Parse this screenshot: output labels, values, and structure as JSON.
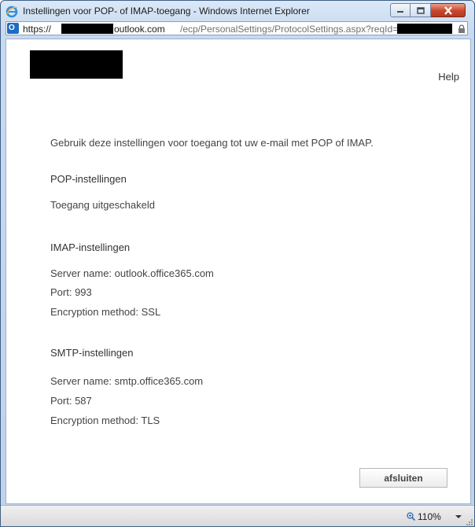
{
  "window": {
    "title": "Instellingen voor POP- of IMAP-toegang - Windows Internet Explorer"
  },
  "address": {
    "scheme": "https://",
    "domain": "outlook.com",
    "path": "/ecp/PersonalSettings/ProtocolSettings.aspx?reqId="
  },
  "page": {
    "help": "Help",
    "intro": "Gebruik deze instellingen voor toegang tot uw e-mail met POP of IMAP.",
    "pop": {
      "heading": "POP-instellingen",
      "status": "Toegang uitgeschakeld"
    },
    "imap": {
      "heading": "IMAP-instellingen",
      "server": "Server name: outlook.office365.com",
      "port": "Port: 993",
      "encryption": "Encryption method: SSL"
    },
    "smtp": {
      "heading": "SMTP-instellingen",
      "server": "Server name: smtp.office365.com",
      "port": "Port: 587",
      "encryption": "Encryption method: TLS"
    },
    "close_button": "afsluiten"
  },
  "status_bar": {
    "zoom": "110%"
  },
  "icons": {
    "browser": "internet-explorer-icon",
    "site": "outlook-favicon-icon",
    "lock": "lock-icon",
    "zoom": "magnifier-icon"
  },
  "colors": {
    "frame": "#c7daf0",
    "close_button_red": "#c8462c",
    "text": "#444444"
  }
}
